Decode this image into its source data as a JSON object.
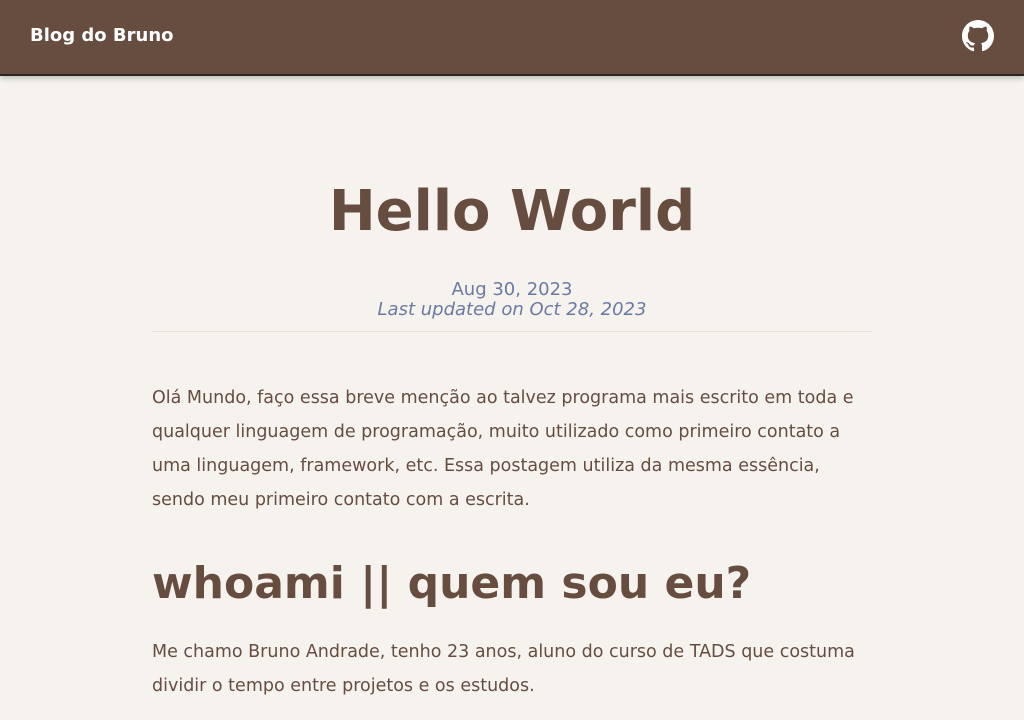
{
  "header": {
    "brand": "Blog do Bruno",
    "github_icon": "github-icon"
  },
  "post": {
    "title": "Hello World",
    "date": "Aug 30, 2023",
    "updated": "Last updated on Oct 28, 2023",
    "intro": "Olá Mundo, faço essa breve menção ao talvez programa mais escrito em toda e qualquer linguagem de programação, muito utilizado como primeiro contato a uma linguagem, framework, etc. Essa postagem utiliza da mesma essência, sendo meu primeiro contato com a escrita.",
    "section_heading": "whoami || quem sou eu?",
    "section_body": "Me chamo Bruno Andrade, tenho 23 anos, aluno do curso de TADS que costuma dividir o tempo entre projetos e os estudos."
  },
  "colors": {
    "header_bg": "#664d3f",
    "page_bg": "#f6f3ef",
    "text": "#664d3f",
    "date": "#6b7aa3"
  }
}
